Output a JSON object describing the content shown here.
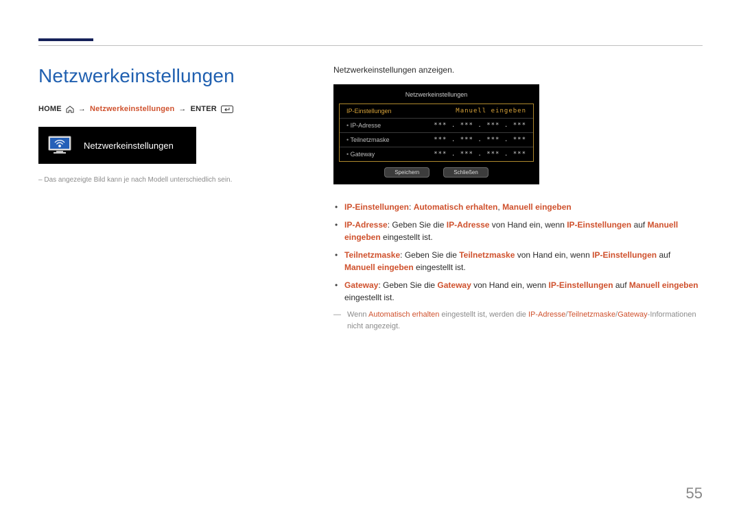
{
  "heading": "Netzwerkeinstellungen",
  "breadcrumb": {
    "home": "HOME",
    "target": "Netzwerkeinstellungen",
    "enter": "ENTER",
    "arrow": "→"
  },
  "tile": {
    "label": "Netzwerkeinstellungen"
  },
  "caption": "Das angezeigte Bild kann je nach Modell unterschiedlich sein.",
  "intro": "Netzwerkeinstellungen anzeigen.",
  "screen": {
    "title": "Netzwerkeinstellungen",
    "header": {
      "k": "IP-Einstellungen",
      "v": "Manuell eingeben"
    },
    "rows": [
      {
        "k": "IP-Adresse",
        "v": "*** . *** . *** . ***"
      },
      {
        "k": "Teilnetzmaske",
        "v": "*** . *** . *** . ***"
      },
      {
        "k": "Gateway",
        "v": "*** . *** . *** . ***"
      }
    ],
    "btn1": "Speichern",
    "btn2": "Schließen"
  },
  "b1": {
    "a": "IP-Einstellungen",
    "b": ": ",
    "c": "Automatisch erhalten",
    "d": ", ",
    "e": "Manuell eingeben"
  },
  "b2": {
    "a": "IP-Adresse",
    "b": ": Geben Sie die ",
    "c": "IP-Adresse",
    "d": " von Hand ein, wenn ",
    "e": "IP-Einstellungen",
    "f": " auf ",
    "g": "Manuell eingeben",
    "h": " eingestellt ist."
  },
  "b3": {
    "a": "Teilnetzmaske",
    "b": ": Geben Sie die ",
    "c": "Teilnetzmaske",
    "d": " von Hand ein, wenn ",
    "e": "IP-Einstellungen",
    "f": " auf ",
    "g": "Manuell eingeben",
    "h": " eingestellt ist."
  },
  "b4": {
    "a": "Gateway",
    "b": ": Geben Sie die ",
    "c": "Gateway",
    "d": " von Hand ein, wenn ",
    "e": "IP-Einstellungen",
    "f": " auf ",
    "g": "Manuell eingeben",
    "h": " eingestellt ist."
  },
  "note": {
    "a": "Wenn ",
    "b": "Automatisch erhalten",
    "c": " eingestellt ist, werden die ",
    "d": "IP-Adresse",
    "e": "/",
    "f": "Teilnetzmaske",
    "g": "/",
    "h": "Gateway",
    "i": "-Informationen nicht angezeigt."
  },
  "pageNumber": "55"
}
